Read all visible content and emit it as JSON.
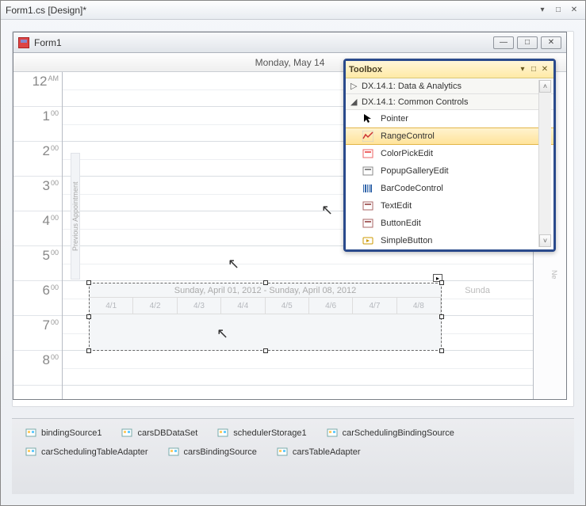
{
  "window": {
    "title": "Form1.cs [Design]*"
  },
  "form": {
    "title": "Form1",
    "date_header": "Monday, May 14",
    "hours": [
      {
        "h": "12",
        "m": "AM"
      },
      {
        "h": "1",
        "m": "00"
      },
      {
        "h": "2",
        "m": "00"
      },
      {
        "h": "3",
        "m": "00"
      },
      {
        "h": "4",
        "m": "00"
      },
      {
        "h": "5",
        "m": "00"
      },
      {
        "h": "6",
        "m": "00"
      },
      {
        "h": "7",
        "m": "00"
      },
      {
        "h": "8",
        "m": "00"
      }
    ],
    "prev_label": "Previous Appointment",
    "next_label": "Ne"
  },
  "range": {
    "caption": "Sunday, April 01, 2012 - Sunday, April 08, 2012",
    "overflow": "Sunda",
    "ticks": [
      "4/1",
      "4/2",
      "4/3",
      "4/4",
      "4/5",
      "4/6",
      "4/7",
      "4/8"
    ]
  },
  "toolbox": {
    "title": "Toolbox",
    "group1": "DX.14.1: Data & Analytics",
    "group2": "DX.14.1: Common Controls",
    "items": [
      {
        "label": "Pointer",
        "icon": "pointer"
      },
      {
        "label": "RangeControl",
        "icon": "range",
        "selected": true
      },
      {
        "label": "ColorPickEdit",
        "icon": "colorpick"
      },
      {
        "label": "PopupGalleryEdit",
        "icon": "gallery"
      },
      {
        "label": "BarCodeControl",
        "icon": "barcode"
      },
      {
        "label": "TextEdit",
        "icon": "textedit"
      },
      {
        "label": "ButtonEdit",
        "icon": "btnedit"
      },
      {
        "label": "SimpleButton",
        "icon": "simplebtn"
      }
    ]
  },
  "tray": [
    "bindingSource1",
    "carsDBDataSet",
    "schedulerStorage1",
    "carSchedulingBindingSource",
    "carSchedulingTableAdapter",
    "carsBindingSource",
    "carsTableAdapter"
  ]
}
